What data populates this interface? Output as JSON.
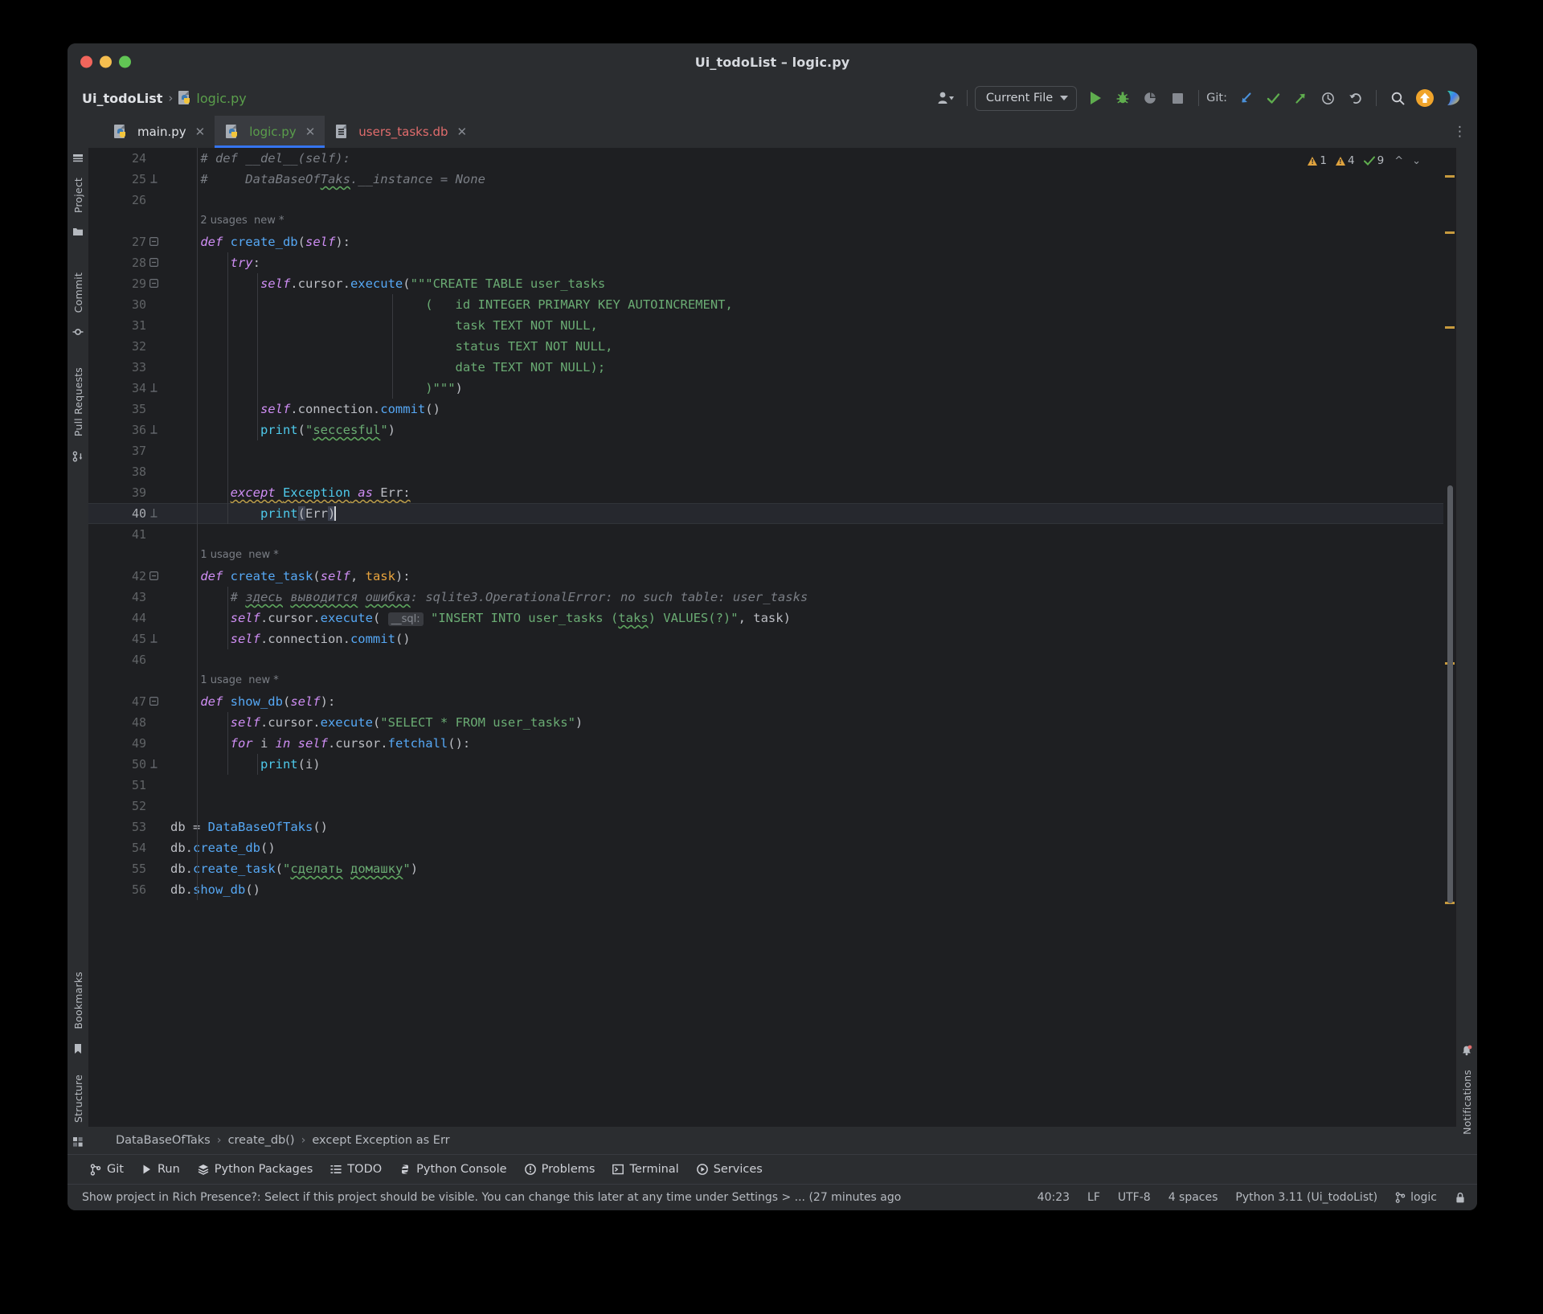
{
  "window": {
    "title": "Ui_todoList – logic.py",
    "traffic_lights": [
      "close",
      "minimize",
      "zoom"
    ]
  },
  "toolbar": {
    "breadcrumb_project": "Ui_todoList",
    "breadcrumb_separator": "›",
    "breadcrumb_file": "logic.py",
    "account_icon": "user-account-icon",
    "run_config": "Current File",
    "run_button": "run-icon",
    "debug_button": "debug-icon",
    "run_coverage_button": "run-with-coverage-icon",
    "stop_button": "stop-icon",
    "git_label": "Git:",
    "git_update": "update-project-icon",
    "git_commit": "commit-icon",
    "git_push": "push-icon",
    "git_history": "history-icon",
    "git_rollback": "rollback-icon",
    "search_everywhere": "search-icon",
    "updates_available": "update-available-icon",
    "ai_assistant": "ai-assistant-icon"
  },
  "tabs": [
    {
      "label": "main.py",
      "icon": "python-file-icon",
      "active": false,
      "color": "#dfe1e5"
    },
    {
      "label": "logic.py",
      "icon": "python-file-icon",
      "active": true,
      "color": "#5a9e4b"
    },
    {
      "label": "users_tasks.db",
      "icon": "database-file-icon",
      "active": false,
      "color": "#e06c6c"
    }
  ],
  "left_strip": [
    {
      "label": "Project",
      "icon": "project-icon"
    },
    {
      "label": "Commit",
      "icon": "commit-icon"
    },
    {
      "label": "Pull Requests",
      "icon": "pull-requests-icon"
    },
    {
      "label": "Bookmarks",
      "icon": "bookmarks-icon"
    },
    {
      "label": "Structure",
      "icon": "structure-icon"
    }
  ],
  "right_strip": [
    {
      "label": "Notifications",
      "icon": "notifications-icon"
    }
  ],
  "inspections": {
    "errors_icon": "warning-triangle-icon",
    "errors_count": "1",
    "warnings_icon": "warning-triangle-icon",
    "warnings_count": "4",
    "weak_warnings_icon": "checkmark-icon",
    "weak_warnings_count": "9",
    "prev_icon": "chevron-up-icon",
    "next_icon": "chevron-down-icon"
  },
  "editor": {
    "first_line": 24,
    "current_line": 40,
    "lines": [
      {
        "n": 24,
        "indent": 1,
        "fold": null,
        "tokens": [
          {
            "t": "# def __del__(self):",
            "c": "cmt"
          }
        ]
      },
      {
        "n": 25,
        "indent": 1,
        "fold": "end",
        "tokens": [
          {
            "t": "#     DataBaseOf",
            "c": "cmt"
          },
          {
            "t": "Taks",
            "c": "cmt wavy-g"
          },
          {
            "t": ".__instance = None",
            "c": "cmt"
          }
        ]
      },
      {
        "n": 26,
        "indent": 0,
        "fold": null,
        "tokens": []
      },
      {
        "n": null,
        "hint": "2 usages  new *"
      },
      {
        "n": 27,
        "indent": 1,
        "fold": "start",
        "tokens": [
          {
            "t": "def ",
            "c": "k"
          },
          {
            "t": "create_db",
            "c": "fn"
          },
          {
            "t": "(",
            "c": "pln"
          },
          {
            "t": "self",
            "c": "slf"
          },
          {
            "t": "):",
            "c": "pln"
          }
        ]
      },
      {
        "n": 28,
        "indent": 2,
        "fold": "start",
        "tokens": [
          {
            "t": "try",
            "c": "k"
          },
          {
            "t": ":",
            "c": "pln"
          }
        ]
      },
      {
        "n": 29,
        "indent": 3,
        "fold": "start",
        "tokens": [
          {
            "t": "self",
            "c": "slf"
          },
          {
            "t": ".cursor.",
            "c": "pln"
          },
          {
            "t": "execute",
            "c": "fn"
          },
          {
            "t": "(",
            "c": "pln"
          },
          {
            "t": "\"\"\"CREATE TABLE user_tasks",
            "c": "str"
          }
        ]
      },
      {
        "n": 30,
        "indent": 0,
        "fold": null,
        "tokens": [
          {
            "t": "(   id INTEGER PRIMARY KEY AUTOINCREMENT,",
            "c": "str"
          }
        ],
        "rawindent": 34
      },
      {
        "n": 31,
        "indent": 0,
        "fold": null,
        "tokens": [
          {
            "t": "task TEXT NOT NULL,",
            "c": "str"
          }
        ],
        "rawindent": 38
      },
      {
        "n": 32,
        "indent": 0,
        "fold": null,
        "tokens": [
          {
            "t": "status TEXT NOT NULL,",
            "c": "str"
          }
        ],
        "rawindent": 38
      },
      {
        "n": 33,
        "indent": 0,
        "fold": null,
        "tokens": [
          {
            "t": "date TEXT NOT NULL);",
            "c": "str"
          }
        ],
        "rawindent": 38
      },
      {
        "n": 34,
        "indent": 0,
        "fold": "end",
        "tokens": [
          {
            "t": ")\"\"\"",
            "c": "str"
          },
          {
            "t": ")",
            "c": "pln"
          }
        ],
        "rawindent": 34
      },
      {
        "n": 35,
        "indent": 3,
        "fold": null,
        "tokens": [
          {
            "t": "self",
            "c": "slf"
          },
          {
            "t": ".connection.",
            "c": "pln"
          },
          {
            "t": "commit",
            "c": "fn"
          },
          {
            "t": "()",
            "c": "pln"
          }
        ]
      },
      {
        "n": 36,
        "indent": 3,
        "fold": "end",
        "tokens": [
          {
            "t": "print",
            "c": "bi"
          },
          {
            "t": "(",
            "c": "pln"
          },
          {
            "t": "\"",
            "c": "str"
          },
          {
            "t": "seccesful",
            "c": "str wavy-g"
          },
          {
            "t": "\"",
            "c": "str"
          },
          {
            "t": ")",
            "c": "pln"
          }
        ]
      },
      {
        "n": 37,
        "indent": 0,
        "fold": null,
        "tokens": []
      },
      {
        "n": 38,
        "indent": 0,
        "fold": null,
        "tokens": []
      },
      {
        "n": 39,
        "indent": 2,
        "fold": null,
        "tokens": [
          {
            "t": "except ",
            "c": "k wavy-y"
          },
          {
            "t": "Exception",
            "c": "cls wavy-y"
          },
          {
            "t": " as ",
            "c": "k wavy-y"
          },
          {
            "t": "Err",
            "c": "pln wavy-y"
          },
          {
            "t": ":",
            "c": "pln wavy-y"
          }
        ]
      },
      {
        "n": 40,
        "indent": 3,
        "fold": "end",
        "current": true,
        "tokens": [
          {
            "t": "print",
            "c": "bi"
          },
          {
            "t": "(",
            "c": "pln brhl"
          },
          {
            "t": "Err",
            "c": "pln"
          },
          {
            "t": ")",
            "c": "pln brhl"
          }
        ],
        "caret_after": true
      },
      {
        "n": 41,
        "indent": 0,
        "fold": null,
        "tokens": []
      },
      {
        "n": null,
        "hint": "1 usage  new *"
      },
      {
        "n": 42,
        "indent": 1,
        "fold": "start",
        "tokens": [
          {
            "t": "def ",
            "c": "k"
          },
          {
            "t": "create_task",
            "c": "fn"
          },
          {
            "t": "(",
            "c": "pln"
          },
          {
            "t": "self",
            "c": "slf"
          },
          {
            "t": ", ",
            "c": "pln"
          },
          {
            "t": "task",
            "c": "prm"
          },
          {
            "t": "):",
            "c": "pln"
          }
        ]
      },
      {
        "n": 43,
        "indent": 2,
        "fold": null,
        "tokens": [
          {
            "t": "# ",
            "c": "cmt"
          },
          {
            "t": "здесь",
            "c": "cmt wavy-g"
          },
          {
            "t": " ",
            "c": "cmt"
          },
          {
            "t": "выводится",
            "c": "cmt wavy-g"
          },
          {
            "t": " ",
            "c": "cmt"
          },
          {
            "t": "ошибка",
            "c": "cmt wavy-g"
          },
          {
            "t": ": sqlite3.OperationalError: no such table: user_tasks",
            "c": "cmt"
          }
        ]
      },
      {
        "n": 44,
        "indent": 2,
        "fold": null,
        "tokens": [
          {
            "t": "self",
            "c": "slf"
          },
          {
            "t": ".cursor.",
            "c": "pln"
          },
          {
            "t": "execute",
            "c": "fn"
          },
          {
            "t": "( ",
            "c": "pln"
          },
          {
            "t": "__sql:",
            "c": "inlay"
          },
          {
            "t": " ",
            "c": "pln"
          },
          {
            "t": "\"INSERT INTO user_tasks (",
            "c": "str"
          },
          {
            "t": "taks",
            "c": "str wavy-g"
          },
          {
            "t": ") VALUES(?)\"",
            "c": "str"
          },
          {
            "t": ", ",
            "c": "pln"
          },
          {
            "t": "task",
            "c": "pln"
          },
          {
            "t": ")",
            "c": "pln"
          }
        ]
      },
      {
        "n": 45,
        "indent": 2,
        "fold": "end",
        "tokens": [
          {
            "t": "self",
            "c": "slf"
          },
          {
            "t": ".connection.",
            "c": "pln"
          },
          {
            "t": "commit",
            "c": "fn"
          },
          {
            "t": "()",
            "c": "pln"
          }
        ]
      },
      {
        "n": 46,
        "indent": 0,
        "fold": null,
        "tokens": []
      },
      {
        "n": null,
        "hint": "1 usage  new *"
      },
      {
        "n": 47,
        "indent": 1,
        "fold": "start",
        "tokens": [
          {
            "t": "def ",
            "c": "k"
          },
          {
            "t": "show_db",
            "c": "fn"
          },
          {
            "t": "(",
            "c": "pln"
          },
          {
            "t": "self",
            "c": "slf"
          },
          {
            "t": "):",
            "c": "pln"
          }
        ]
      },
      {
        "n": 48,
        "indent": 2,
        "fold": null,
        "tokens": [
          {
            "t": "self",
            "c": "slf"
          },
          {
            "t": ".cursor.",
            "c": "pln"
          },
          {
            "t": "execute",
            "c": "fn"
          },
          {
            "t": "(",
            "c": "pln"
          },
          {
            "t": "\"SELECT * FROM user_tasks\"",
            "c": "str"
          },
          {
            "t": ")",
            "c": "pln"
          }
        ]
      },
      {
        "n": 49,
        "indent": 2,
        "fold": null,
        "tokens": [
          {
            "t": "for ",
            "c": "k"
          },
          {
            "t": "i ",
            "c": "pln"
          },
          {
            "t": "in ",
            "c": "k"
          },
          {
            "t": "self",
            "c": "slf"
          },
          {
            "t": ".cursor.",
            "c": "pln"
          },
          {
            "t": "fetchall",
            "c": "fn"
          },
          {
            "t": "():",
            "c": "pln"
          }
        ]
      },
      {
        "n": 50,
        "indent": 3,
        "fold": "end",
        "tokens": [
          {
            "t": "print",
            "c": "bi"
          },
          {
            "t": "(i)",
            "c": "pln"
          }
        ]
      },
      {
        "n": 51,
        "indent": 0,
        "fold": null,
        "tokens": []
      },
      {
        "n": 52,
        "indent": 0,
        "fold": null,
        "tokens": []
      },
      {
        "n": 53,
        "indent": 0,
        "fold": null,
        "tokens": [
          {
            "t": "db = ",
            "c": "pln"
          },
          {
            "t": "DataBaseOfTaks",
            "c": "fn"
          },
          {
            "t": "()",
            "c": "pln"
          }
        ]
      },
      {
        "n": 54,
        "indent": 0,
        "fold": null,
        "tokens": [
          {
            "t": "db.",
            "c": "pln"
          },
          {
            "t": "create_db",
            "c": "fn"
          },
          {
            "t": "()",
            "c": "pln"
          }
        ]
      },
      {
        "n": 55,
        "indent": 0,
        "fold": null,
        "tokens": [
          {
            "t": "db.",
            "c": "pln"
          },
          {
            "t": "create_task",
            "c": "fn"
          },
          {
            "t": "(",
            "c": "pln"
          },
          {
            "t": "\"",
            "c": "str"
          },
          {
            "t": "сделать",
            "c": "str wavy-g"
          },
          {
            "t": " ",
            "c": "str"
          },
          {
            "t": "домашку",
            "c": "str wavy-g"
          },
          {
            "t": "\"",
            "c": "str"
          },
          {
            "t": ")",
            "c": "pln"
          }
        ]
      },
      {
        "n": 56,
        "indent": 0,
        "fold": null,
        "tokens": [
          {
            "t": "db.",
            "c": "pln"
          },
          {
            "t": "show_db",
            "c": "fn"
          },
          {
            "t": "()",
            "c": "pln"
          }
        ]
      }
    ]
  },
  "breadcrumbs": [
    "DataBaseOfTaks",
    "create_db()",
    "except Exception as Err"
  ],
  "bottom_tools": [
    {
      "label": "Git",
      "icon": "git-icon"
    },
    {
      "label": "Run",
      "icon": "run-icon"
    },
    {
      "label": "Python Packages",
      "icon": "packages-icon"
    },
    {
      "label": "TODO",
      "icon": "todo-icon"
    },
    {
      "label": "Python Console",
      "icon": "python-console-icon"
    },
    {
      "label": "Problems",
      "icon": "problems-icon"
    },
    {
      "label": "Terminal",
      "icon": "terminal-icon"
    },
    {
      "label": "Services",
      "icon": "services-icon"
    }
  ],
  "statusbar": {
    "message": "Show project in Rich Presence?: Select if this project should be visible. You can change this later at any time under Settings > ... (27 minutes ago",
    "caret_position": "40:23",
    "line_separator": "LF",
    "encoding": "UTF-8",
    "indent": "4 spaces",
    "interpreter": "Python 3.11 (Ui_todoList)",
    "branch_icon": "git-branch-icon",
    "branch": "logic",
    "lock_icon": "readonly-lock-icon"
  },
  "colors": {
    "accent": "#3574f0",
    "background": "#1e1f22",
    "chrome": "#2b2d30",
    "string": "#6aab73",
    "keyword": "#cf8ef4",
    "function": "#56a8f5",
    "comment": "#7a7e85"
  }
}
